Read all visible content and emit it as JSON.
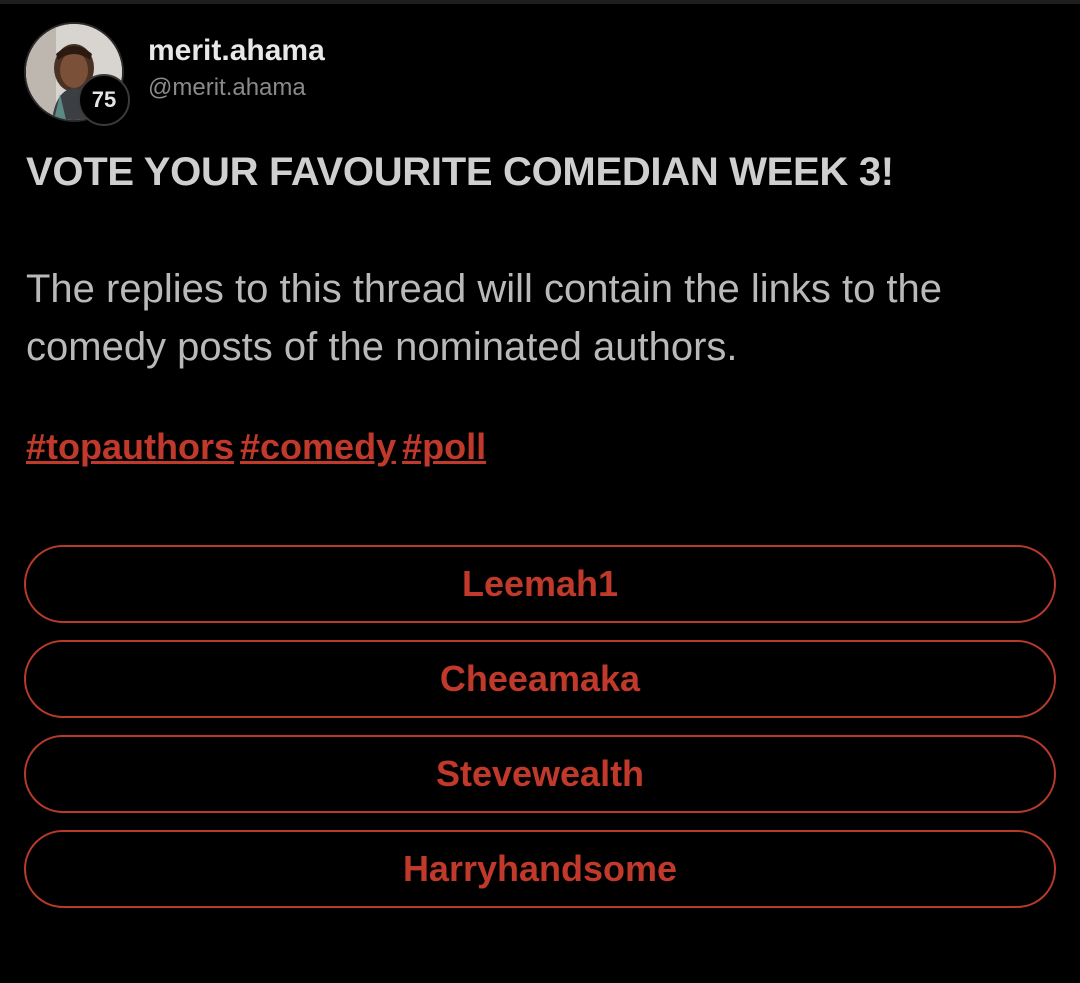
{
  "author": {
    "display_name": "merit.ahama",
    "handle": "@merit.ahama",
    "level": "75"
  },
  "post": {
    "title": "VOTE YOUR FAVOURITE COMEDIAN WEEK 3!",
    "body": "The replies to this thread will contain the links to the comedy posts of the nominated authors.",
    "hashtags": [
      "#topauthors",
      "#comedy",
      "#poll"
    ]
  },
  "poll": {
    "options": [
      "Leemah1",
      "Cheeamaka",
      "Stevewealth",
      "Harryhandsome"
    ]
  },
  "colors": {
    "accent": "#c0392b",
    "background": "#000000",
    "text": "#cfcfcf",
    "muted": "#8a8a8a"
  }
}
